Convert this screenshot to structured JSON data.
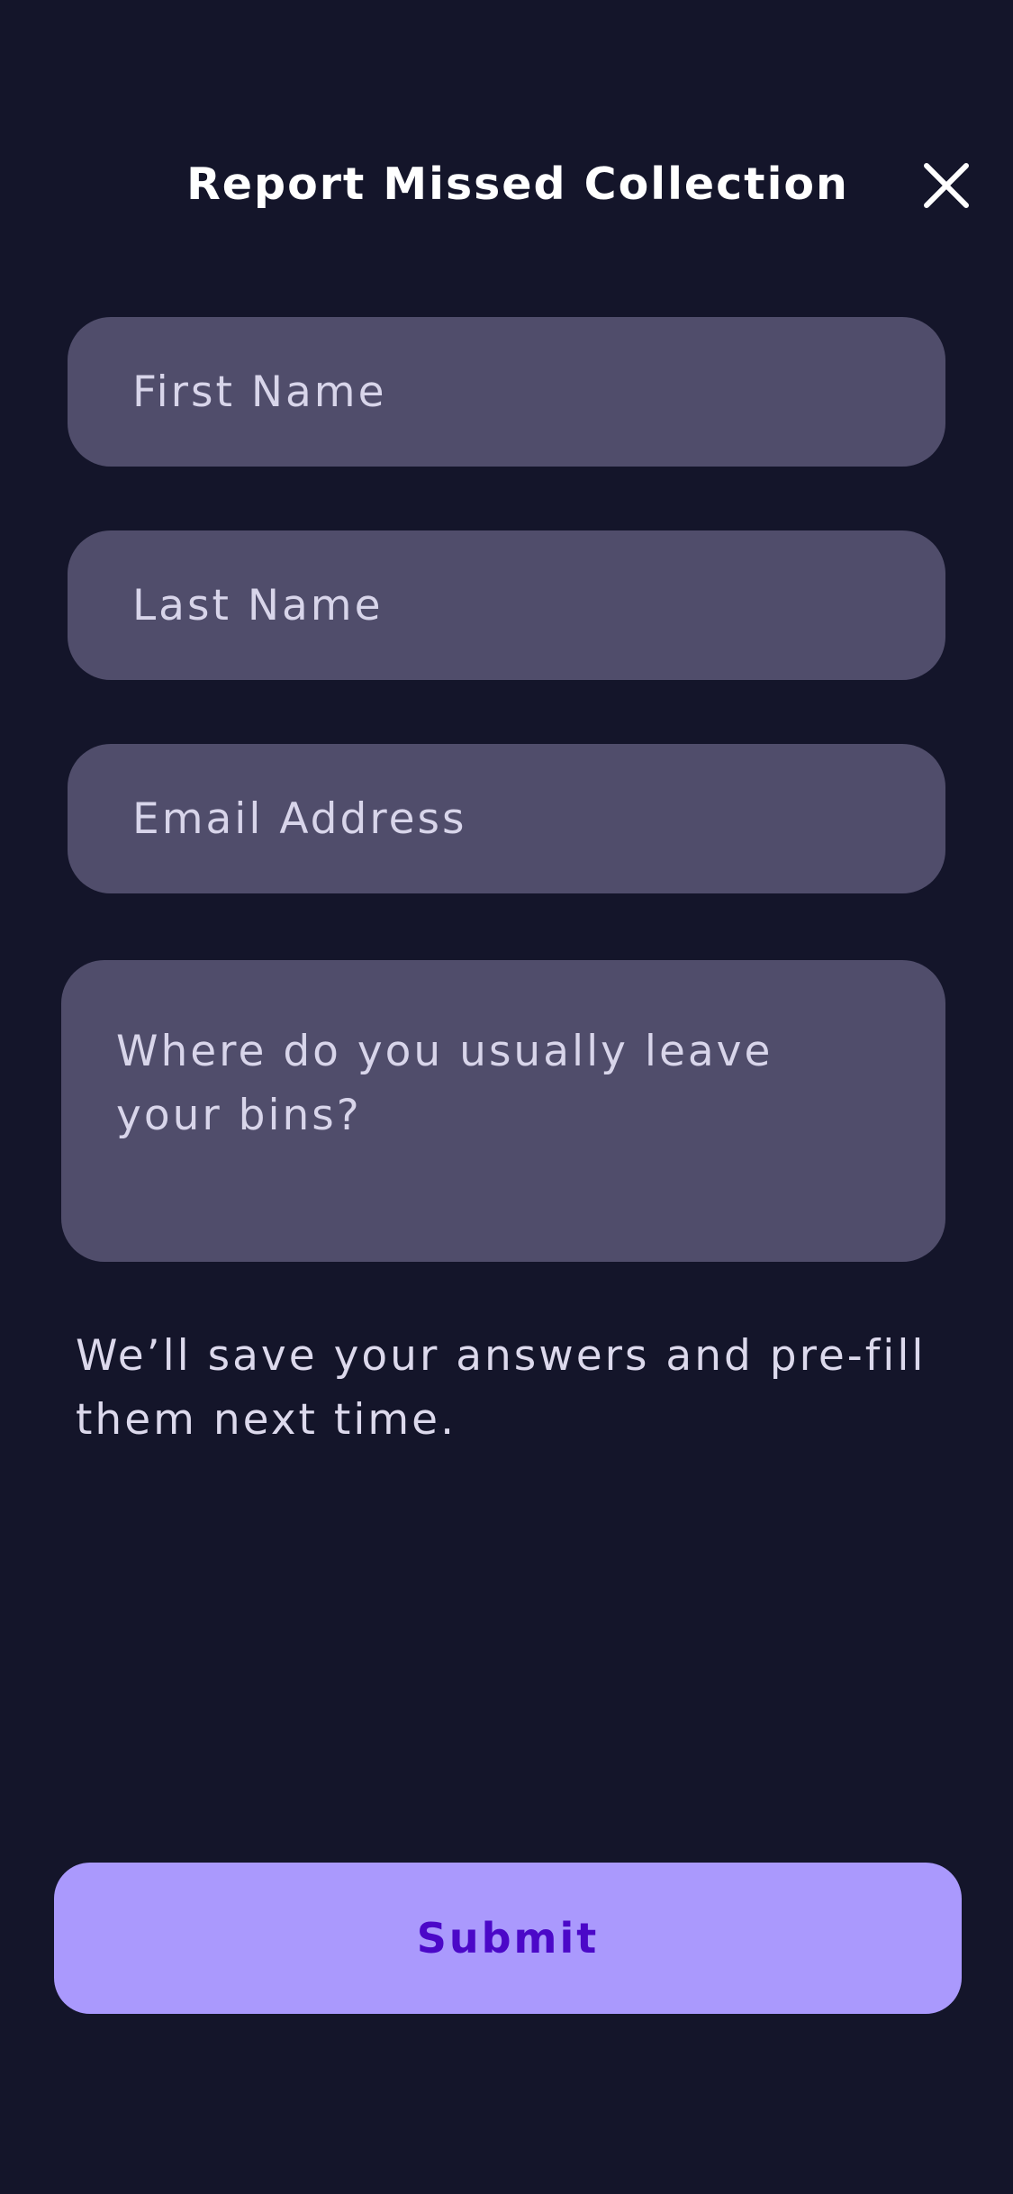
{
  "header": {
    "title": "Report Missed Collection",
    "close_icon": "close-icon"
  },
  "form": {
    "first_name": {
      "placeholder": "First Name",
      "value": ""
    },
    "last_name": {
      "placeholder": "Last Name",
      "value": ""
    },
    "email": {
      "placeholder": "Email Address",
      "value": ""
    },
    "bins_location": {
      "placeholder": "Where do you usually leave your bins?",
      "value": ""
    },
    "helper_text": "We’ll save your answers and pre-fill them next time."
  },
  "actions": {
    "submit_label": "Submit"
  },
  "colors": {
    "background": "#14152a",
    "field": "#504d6b",
    "button": "#aa99fd",
    "button_text": "#4b08c8"
  }
}
